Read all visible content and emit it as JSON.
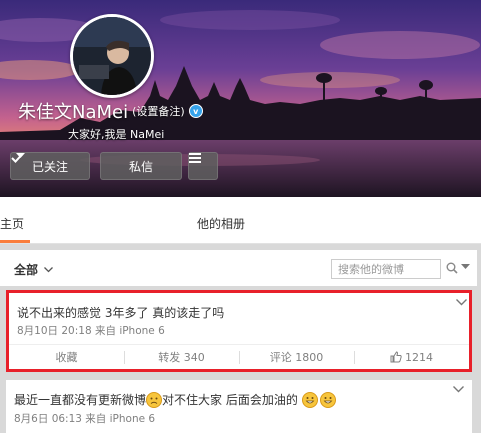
{
  "profile": {
    "name": "朱佳文NaMei",
    "remark_link": "(设置备注)",
    "bio": "大家好,我是 NaMei"
  },
  "actions": {
    "follow_label": "已关注",
    "message_label": "私信"
  },
  "tabs": {
    "home": "他主页",
    "album": "他的相册"
  },
  "filter": {
    "all_label": "全部",
    "search_placeholder": "搜索他的微博"
  },
  "posts": [
    {
      "text": "说不出来的感觉 3年多了 真的该走了吗",
      "meta": "8月10日 20:18 来自 iPhone 6",
      "actions": {
        "collect": "收藏",
        "repost": "转发 340",
        "comment": "评论 1800",
        "like": "1214"
      }
    },
    {
      "text_part1": "最近一直都没有更新微博",
      "text_part2": " 对不住大家 后面会加油的",
      "meta": "8月6日 06:13 来自 iPhone 6"
    }
  ],
  "colors": {
    "accent_orange": "#fa7d3c",
    "highlight_red": "#e8202a",
    "verified_blue": "#36a3eb"
  }
}
